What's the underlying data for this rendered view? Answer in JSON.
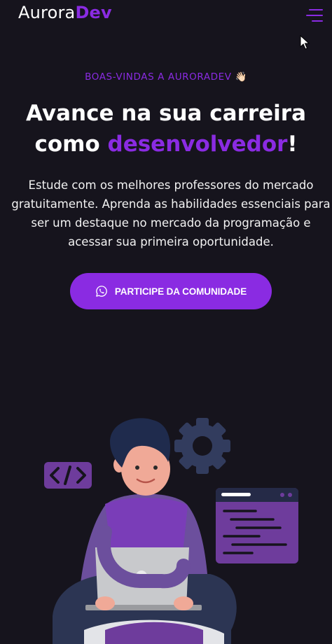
{
  "header": {
    "logo_part1": "Aurora",
    "logo_part2": "Dev",
    "menu_icon": "hamburger-icon"
  },
  "hero": {
    "eyebrow": "BOAS-VINDAS A AURORADEV 👋🏻",
    "title_line1": "Avance na sua carreira",
    "title_prefix": "como ",
    "title_highlight": "desenvolvedor",
    "title_suffix": "!",
    "description": "Estude com os melhores professores do mercado gratuitamente. Aprenda as habilidades essenciais para ser um destaque no mercado da programação e acessar sua primeira oportunidade.",
    "cta_label": "PARTICIPE DA COMUNIDADE",
    "cta_icon": "whatsapp-icon"
  },
  "illustration": {
    "code_badge": "</>",
    "icons": [
      "code-icon",
      "gear-icon",
      "code-window-icon",
      "laptop-icon"
    ]
  },
  "colors": {
    "background": "#16141d",
    "accent": "#8a2be2",
    "text": "#ffffff"
  }
}
